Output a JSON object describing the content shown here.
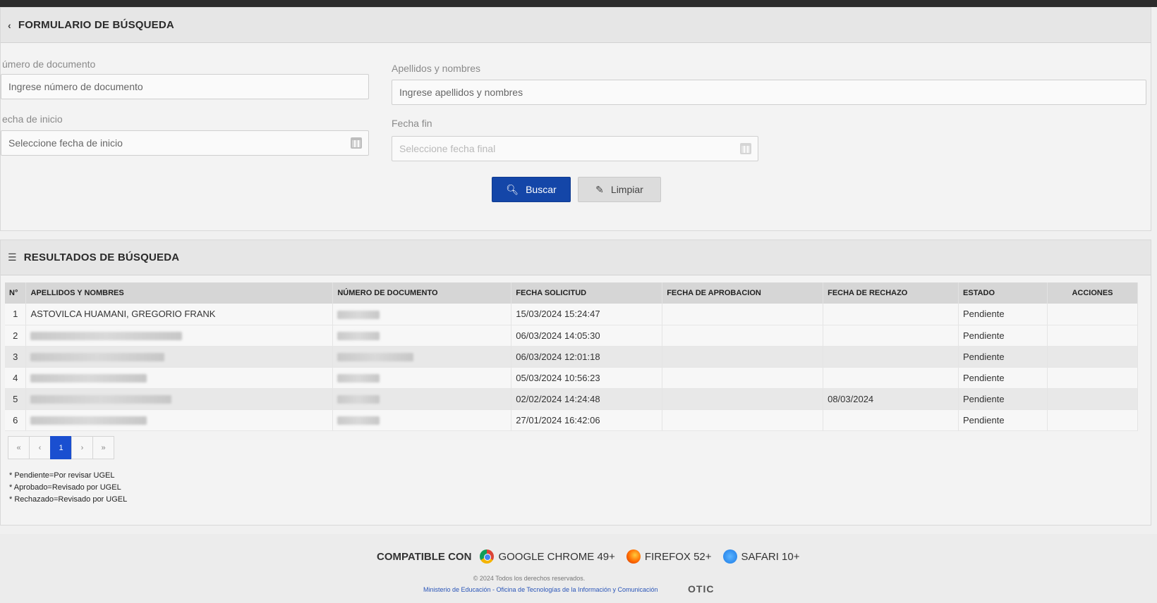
{
  "search_form": {
    "title": "FORMULARIO DE BÚSQUEDA",
    "doc_number": {
      "label": "úmero de documento",
      "placeholder": "Ingrese número de documento"
    },
    "names": {
      "label": "Apellidos y nombres",
      "placeholder": "Ingrese apellidos y nombres"
    },
    "start_date": {
      "label": "echa de inicio",
      "placeholder": "Seleccione fecha de inicio"
    },
    "end_date": {
      "label": "Fecha fin",
      "placeholder": "Seleccione fecha final"
    },
    "search_button": "Buscar",
    "clear_button": "Limpiar"
  },
  "results": {
    "title": "RESULTADOS DE BÚSQUEDA",
    "columns": [
      "N°",
      "APELLIDOS Y NOMBRES",
      "NÚMERO DE DOCUMENTO",
      "FECHA SOLICITUD",
      "FECHA DE APROBACION",
      "FECHA DE RECHAZO",
      "ESTADO",
      "ACCIONES"
    ],
    "rows": [
      {
        "n": "1",
        "name": "ASTOVILCA HUAMANI, GREGORIO FRANK",
        "doc": "",
        "requested": "15/03/2024 15:24:47",
        "approved": "",
        "rejected": "",
        "status": "Pendiente"
      },
      {
        "n": "2",
        "name": "",
        "doc": "",
        "requested": "06/03/2024 14:05:30",
        "approved": "",
        "rejected": "",
        "status": "Pendiente"
      },
      {
        "n": "3",
        "name": "",
        "doc": "",
        "requested": "06/03/2024 12:01:18",
        "approved": "",
        "rejected": "",
        "status": "Pendiente"
      },
      {
        "n": "4",
        "name": "",
        "doc": "",
        "requested": "05/03/2024 10:56:23",
        "approved": "",
        "rejected": "",
        "status": "Pendiente"
      },
      {
        "n": "5",
        "name": "",
        "doc": "",
        "requested": "02/02/2024 14:24:48",
        "approved": "",
        "rejected": "08/03/2024",
        "status": "Pendiente"
      },
      {
        "n": "6",
        "name": "",
        "doc": "",
        "requested": "27/01/2024 16:42:06",
        "approved": "",
        "rejected": "",
        "status": "Pendiente"
      }
    ],
    "pagination": {
      "first": "«",
      "prev": "‹",
      "current": "1",
      "next": "›",
      "last": "»"
    },
    "notes": [
      "* Pendiente=Por revisar UGEL",
      "* Aprobado=Revisado por UGEL",
      "* Rechazado=Revisado por UGEL"
    ]
  },
  "footer": {
    "compatible_label": "COMPATIBLE CON",
    "browsers": [
      "GOOGLE CHROME 49+",
      "FIREFOX 52+",
      "SAFARI 10+"
    ],
    "copyright": "© 2024 Todos los derechos reservados.",
    "ministry": "Ministerio de Educación - Oficina de Tecnologías de la Información y Comunicación",
    "otic": "OTIC"
  }
}
